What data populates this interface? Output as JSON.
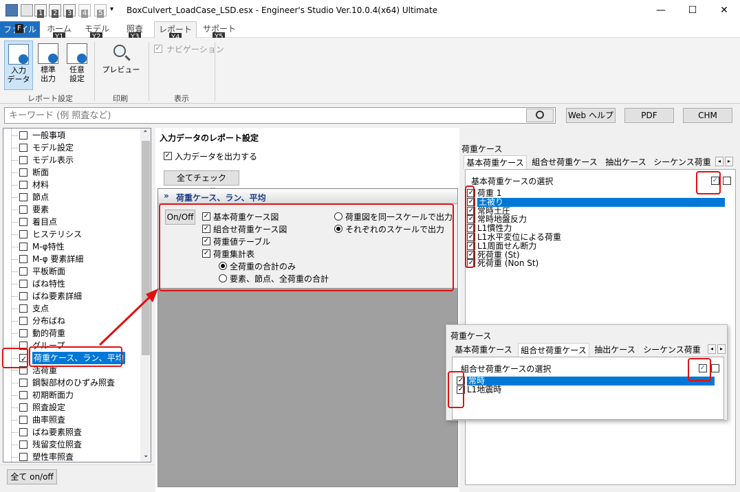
{
  "window": {
    "title": "BoxCulvert_LoadCase_LSD.esx - Engineer's Studio Ver.10.0.4(x64) Ultimate"
  },
  "quick_access": [
    "1",
    "2",
    "3",
    "4",
    "5"
  ],
  "menu": {
    "file": "ファイル",
    "file_key": "F",
    "tabs": [
      {
        "label": "ホーム",
        "key": "Y1"
      },
      {
        "label": "モデル",
        "key": "Y2"
      },
      {
        "label": "照査",
        "key": "Y3"
      },
      {
        "label": "レポート",
        "key": "Y4"
      },
      {
        "label": "サポート",
        "key": "Y5"
      }
    ]
  },
  "ribbon": {
    "input_data": "入力\nデータ",
    "standard_output": "標準\n出力",
    "custom_settings": "任意\n設定",
    "preview": "プレビュー",
    "navigation": "ナビゲーション",
    "group_report": "レポート設定",
    "group_print": "印刷",
    "group_display": "表示"
  },
  "search": {
    "placeholder": "キーワード (例 照査など)"
  },
  "buttons": {
    "web_help": "Web ヘルプ",
    "pdf": "PDF",
    "chm": "CHM",
    "all_onoff": "全て on/off"
  },
  "tree": {
    "items": [
      "一般事項",
      "モデル設定",
      "モデル表示",
      "断面",
      "材料",
      "節点",
      "要素",
      "着目点",
      "ヒステリシス",
      "M-φ特性",
      "M-φ 要素詳細",
      "平板断面",
      "ばね特性",
      "ばね要素詳細",
      "支点",
      "分布ばね",
      "動的荷重",
      "グループ",
      "荷重ケース、ラン、平均",
      "活荷重",
      "鋼製部材のひずみ照査",
      "初期断面力",
      "照査設定",
      "曲率照査",
      "ばね要素照査",
      "残留変位照査",
      "塑性率照査"
    ],
    "selected_index": 18
  },
  "main": {
    "title": "入力データのレポート設定",
    "output_input_data": "入力データを出力する",
    "all_check_button": "全てチェック On/Off",
    "section_title": "荷重ケース、ラン、平均",
    "onoff_button": "On/Off",
    "options": [
      "基本荷重ケース図",
      "組合せ荷重ケース図",
      "荷重値テーブル",
      "荷重集計表"
    ],
    "sub_radios": [
      "全荷重の合計のみ",
      "要素、節点、全荷重の合計"
    ],
    "scale_radios": [
      "荷重図を同一スケールで出力",
      "それぞれのスケールで出力"
    ]
  },
  "loadcase_panel": {
    "title": "荷重ケース",
    "tabs": [
      "基本荷重ケース",
      "組合せ荷重ケース",
      "抽出ケース",
      "シーケンス荷重"
    ],
    "select_label": "基本荷重ケースの選択",
    "items": [
      "荷重 1",
      "土被り",
      "常時土圧",
      "常時地盤反力",
      "L1慣性力",
      "L1水平変位による荷重",
      "L1周面せん断力",
      "死荷重 (St)",
      "死荷重 (Non St)"
    ],
    "selected_index": 1
  },
  "combo_panel": {
    "title": "荷重ケース",
    "tabs": [
      "基本荷重ケース",
      "組合せ荷重ケース",
      "抽出ケース",
      "シーケンス荷重"
    ],
    "select_label": "組合せ荷重ケースの選択",
    "items": [
      "常時",
      "L1地震時"
    ],
    "selected_index": 0
  }
}
